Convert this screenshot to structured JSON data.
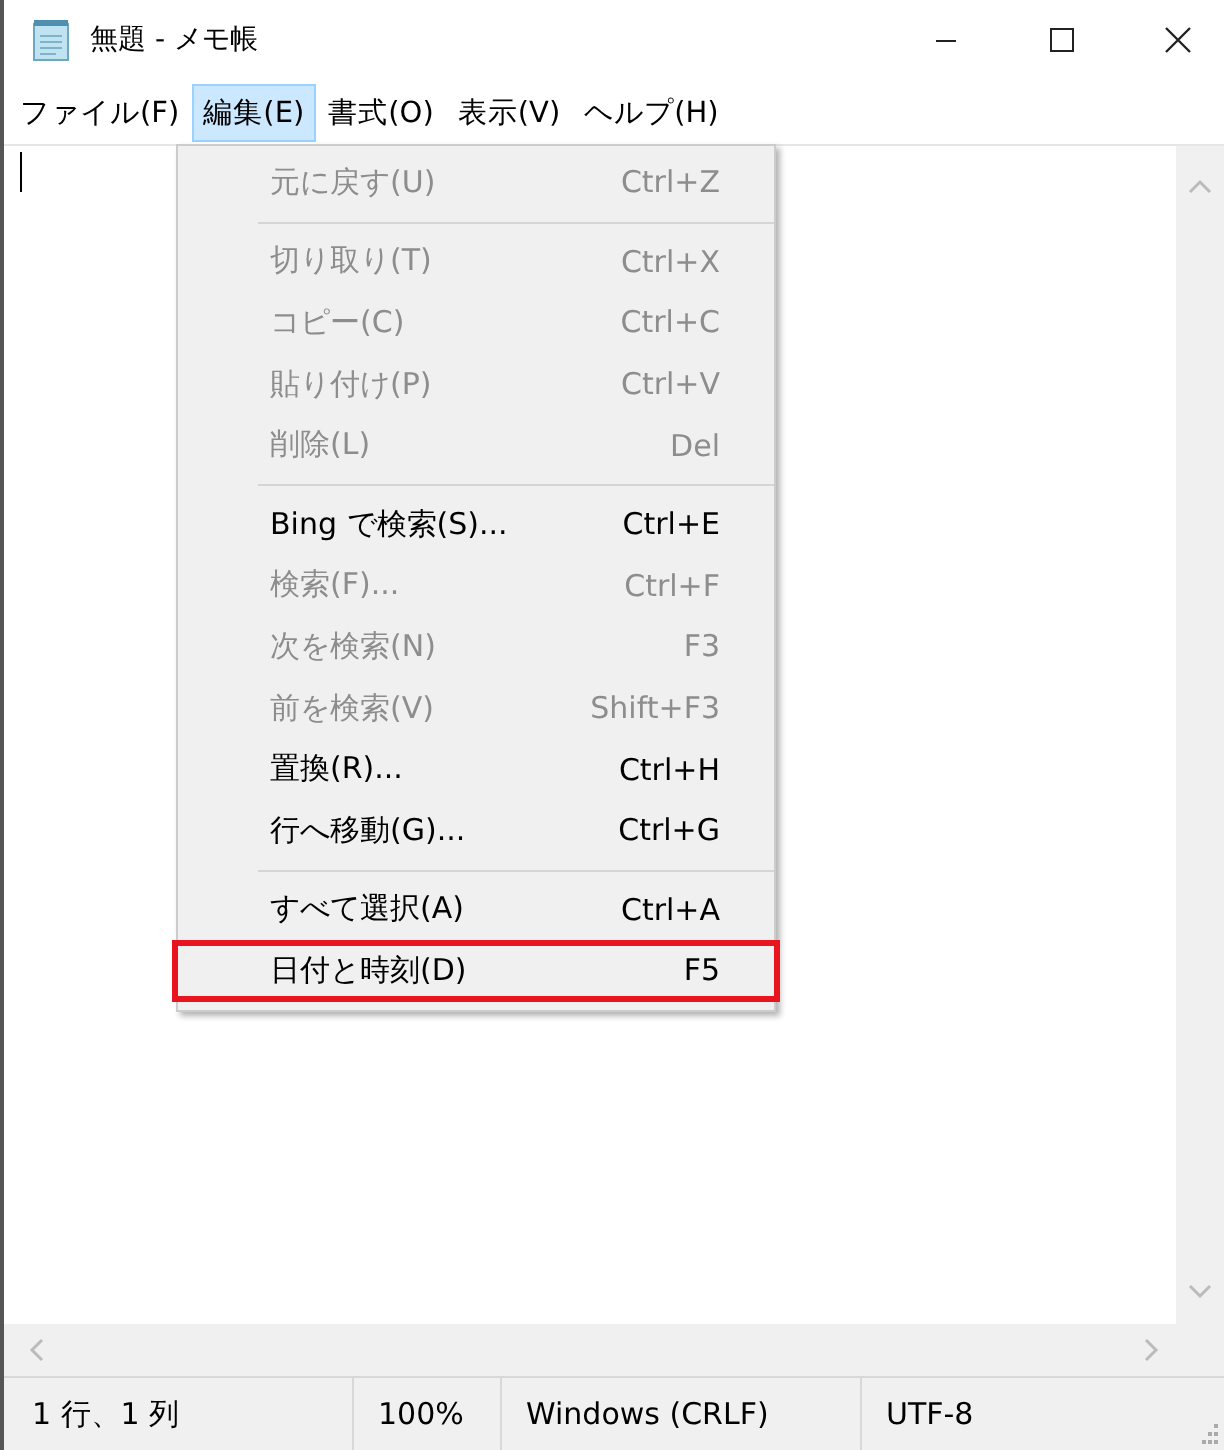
{
  "window": {
    "title": "無題 - メモ帳"
  },
  "menu_bar": [
    {
      "label": "ファイル(F)",
      "selected": false
    },
    {
      "label": "編集(E)",
      "selected": true
    },
    {
      "label": "書式(O)",
      "selected": false
    },
    {
      "label": "表示(V)",
      "selected": false
    },
    {
      "label": "ヘルプ(H)",
      "selected": false
    }
  ],
  "edit_menu": [
    {
      "kind": "item",
      "label": "元に戻す(U)",
      "shortcut": "Ctrl+Z",
      "disabled": true,
      "annotated": false
    },
    {
      "kind": "separator"
    },
    {
      "kind": "item",
      "label": "切り取り(T)",
      "shortcut": "Ctrl+X",
      "disabled": true,
      "annotated": false
    },
    {
      "kind": "item",
      "label": "コピー(C)",
      "shortcut": "Ctrl+C",
      "disabled": true,
      "annotated": false
    },
    {
      "kind": "item",
      "label": "貼り付け(P)",
      "shortcut": "Ctrl+V",
      "disabled": true,
      "annotated": false
    },
    {
      "kind": "item",
      "label": "削除(L)",
      "shortcut": "Del",
      "disabled": true,
      "annotated": false
    },
    {
      "kind": "separator"
    },
    {
      "kind": "item",
      "label": "Bing で検索(S)...",
      "shortcut": "Ctrl+E",
      "disabled": false,
      "annotated": false
    },
    {
      "kind": "item",
      "label": "検索(F)...",
      "shortcut": "Ctrl+F",
      "disabled": true,
      "annotated": false
    },
    {
      "kind": "item",
      "label": "次を検索(N)",
      "shortcut": "F3",
      "disabled": true,
      "annotated": false
    },
    {
      "kind": "item",
      "label": "前を検索(V)",
      "shortcut": "Shift+F3",
      "disabled": true,
      "annotated": false
    },
    {
      "kind": "item",
      "label": "置換(R)...",
      "shortcut": "Ctrl+H",
      "disabled": false,
      "annotated": false
    },
    {
      "kind": "item",
      "label": "行へ移動(G)...",
      "shortcut": "Ctrl+G",
      "disabled": false,
      "annotated": false
    },
    {
      "kind": "separator"
    },
    {
      "kind": "item",
      "label": "すべて選択(A)",
      "shortcut": "Ctrl+A",
      "disabled": false,
      "annotated": false
    },
    {
      "kind": "item",
      "label": "日付と時刻(D)",
      "shortcut": "F5",
      "disabled": false,
      "annotated": true
    }
  ],
  "status_bar": [
    "1 行、1 列",
    "100%",
    "Windows (CRLF)",
    "UTF-8"
  ]
}
